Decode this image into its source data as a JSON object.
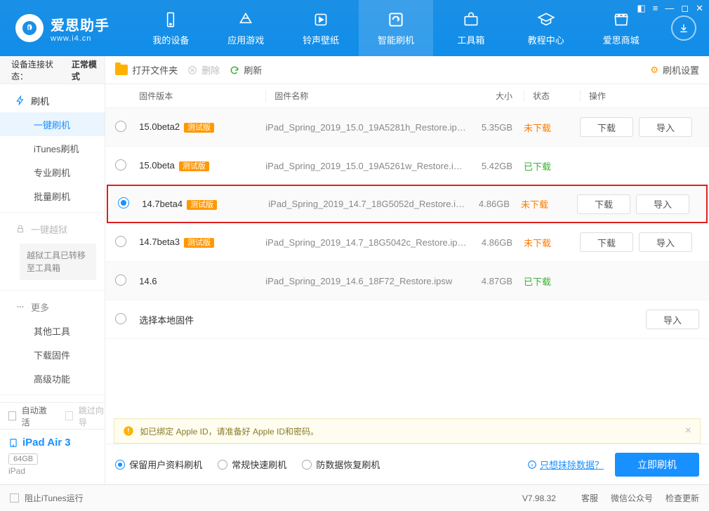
{
  "brand": {
    "name": "爱思助手",
    "url": "www.i4.cn"
  },
  "nav": {
    "items": [
      {
        "label": "我的设备"
      },
      {
        "label": "应用游戏"
      },
      {
        "label": "铃声壁纸"
      },
      {
        "label": "智能刷机"
      },
      {
        "label": "工具箱"
      },
      {
        "label": "教程中心"
      },
      {
        "label": "爱思商城"
      }
    ]
  },
  "sidebar": {
    "status_label": "设备连接状态：",
    "status_value": "正常模式",
    "flash_section": "刷机",
    "flash_items": [
      "一键刷机",
      "iTunes刷机",
      "专业刷机",
      "批量刷机"
    ],
    "jailbreak_title": "一键越狱",
    "jailbreak_note": "越狱工具已转移至工具箱",
    "more_title": "更多",
    "more_items": [
      "其他工具",
      "下载固件",
      "高级功能"
    ],
    "auto_activate": "自动激活",
    "skip_guide": "跳过向导",
    "device_name": "iPad Air 3",
    "device_storage": "64GB",
    "device_type": "iPad",
    "block_itunes": "阻止iTunes运行"
  },
  "toolbar": {
    "open_folder": "打开文件夹",
    "delete": "删除",
    "refresh": "刷新",
    "settings": "刷机设置"
  },
  "columns": {
    "version": "固件版本",
    "name": "固件名称",
    "size": "大小",
    "status": "状态",
    "action": "操作"
  },
  "status_labels": {
    "not_downloaded": "未下载",
    "downloaded": "已下载"
  },
  "buttons": {
    "download": "下载",
    "import": "导入"
  },
  "rows": [
    {
      "version": "15.0beta2",
      "beta": "测试版",
      "name": "iPad_Spring_2019_15.0_19A5281h_Restore.ip…",
      "size": "5.35GB",
      "status": "not_downloaded",
      "selected": false,
      "actions": [
        "download",
        "import"
      ]
    },
    {
      "version": "15.0beta",
      "beta": "测试版",
      "name": "iPad_Spring_2019_15.0_19A5261w_Restore.i…",
      "size": "5.42GB",
      "status": "downloaded",
      "selected": false,
      "actions": []
    },
    {
      "version": "14.7beta4",
      "beta": "测试版",
      "name": "iPad_Spring_2019_14.7_18G5052d_Restore.i…",
      "size": "4.86GB",
      "status": "not_downloaded",
      "selected": true,
      "actions": [
        "download",
        "import"
      ]
    },
    {
      "version": "14.7beta3",
      "beta": "测试版",
      "name": "iPad_Spring_2019_14.7_18G5042c_Restore.ip…",
      "size": "4.86GB",
      "status": "not_downloaded",
      "selected": false,
      "actions": [
        "download",
        "import"
      ]
    },
    {
      "version": "14.6",
      "beta": "",
      "name": "iPad_Spring_2019_14.6_18F72_Restore.ipsw",
      "size": "4.87GB",
      "status": "downloaded",
      "selected": false,
      "actions": []
    }
  ],
  "local_row": {
    "label": "选择本地固件"
  },
  "notice": "如已绑定 Apple ID，请准备好 Apple ID和密码。",
  "flash_options": {
    "items": [
      "保留用户资料刷机",
      "常规快速刷机",
      "防数据恢复刷机"
    ],
    "selected": 0,
    "erase_link": "只想抹除数据？",
    "flash_button": "立即刷机"
  },
  "footer": {
    "version": "V7.98.32",
    "service": "客服",
    "wechat": "微信公众号",
    "update": "检查更新"
  }
}
